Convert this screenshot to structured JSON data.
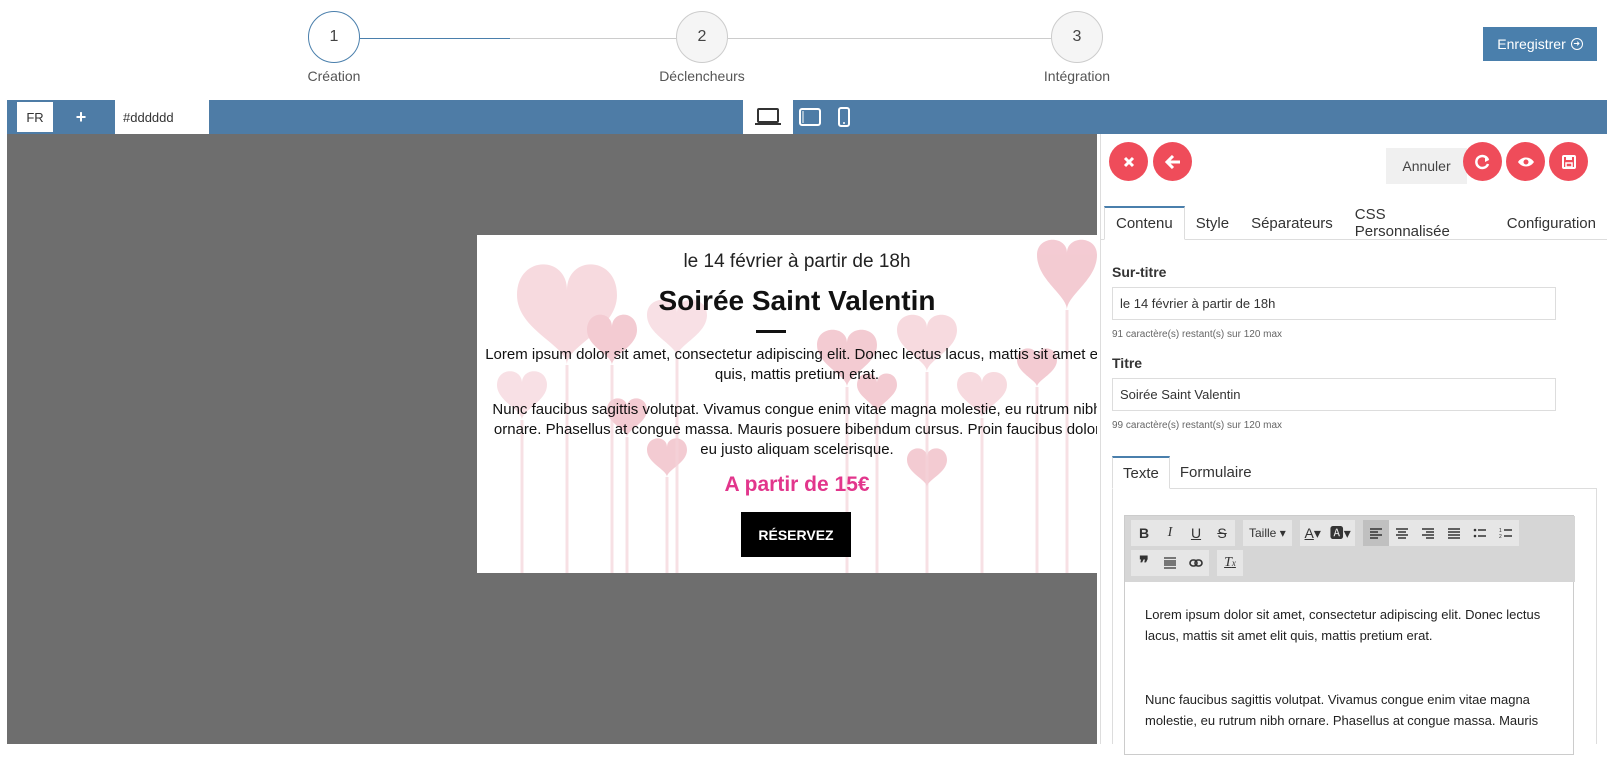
{
  "steps": [
    {
      "num": "1",
      "label": "Création"
    },
    {
      "num": "2",
      "label": "Déclencheurs"
    },
    {
      "num": "3",
      "label": "Intégration"
    }
  ],
  "save_top": "Enregistrer",
  "toolbar": {
    "lang": "FR",
    "plus": "+",
    "color": "#dddddd",
    "devices": [
      "laptop-icon",
      "tablet-icon",
      "mobile-icon"
    ]
  },
  "preview": {
    "subtitle": "le 14 février à partir de 18h",
    "title": "Soirée Saint Valentin",
    "p1": "Lorem ipsum dolor sit amet, consectetur adipiscing elit. Donec lectus lacus, mattis sit amet elit quis, mattis pretium erat.",
    "p2": "Nunc faucibus sagittis volutpat. Vivamus congue enim vitae magna molestie, eu rutrum nibh ornare. Phasellus at congue massa. Mauris posuere bibendum cursus. Proin faucibus dolor eu justo aliquam scelerisque.",
    "price": "A partir de 15€",
    "button": "RÉSERVEZ",
    "price_color": "#e2368c"
  },
  "panel": {
    "annuler": "Annuler",
    "tabs": [
      "Contenu",
      "Style",
      "Séparateurs",
      "CSS Personnalisée",
      "Configuration"
    ],
    "surtitre": {
      "label": "Sur-titre",
      "value": "le 14 février à partir de 18h",
      "help": "91 caractère(s) restant(s) sur 120 max"
    },
    "titre": {
      "label": "Titre",
      "value": "Soirée Saint Valentin",
      "help": "99 caractère(s) restant(s) sur 120 max"
    },
    "subtabs": [
      "Texte",
      "Formulaire"
    ],
    "editor": {
      "size_label": "Taille",
      "p1": "Lorem ipsum dolor sit amet, consectetur adipiscing elit. Donec lectus lacus, mattis sit amet elit quis, mattis pretium erat.",
      "p2": "Nunc faucibus sagittis volutpat. Vivamus congue enim vitae magna molestie, eu rutrum nibh ornare. Phasellus at congue massa. Mauris"
    }
  },
  "colors": {
    "accent": "#4a7fac",
    "danger": "#ef4c5a",
    "canvas": "#6e6e6e"
  }
}
